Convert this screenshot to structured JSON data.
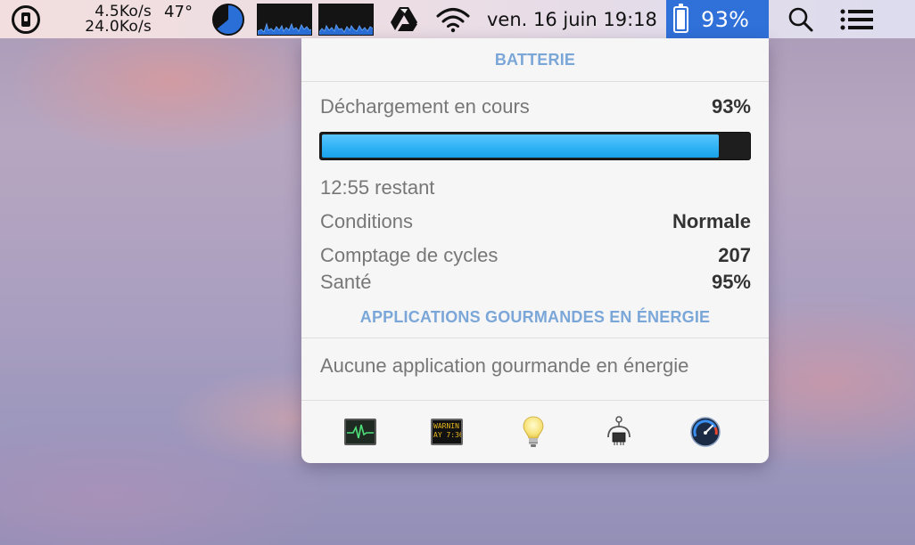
{
  "menubar": {
    "net_up": "4.5Ko/s",
    "net_down": "24.0Ko/s",
    "temperature": "47°",
    "cpu_pie_fraction": 0.64,
    "datetime": "ven. 16 juin 19:18",
    "battery_percent": "93%",
    "icons": [
      "onepassword-icon",
      "cpu-pie-icon",
      "cpu-graph-icon",
      "memory-graph-icon",
      "google-drive-icon",
      "wifi-icon",
      "battery-icon",
      "spotlight-search-icon",
      "notification-center-icon"
    ],
    "colors": {
      "battery_highlight": "#2f70d9"
    }
  },
  "popover": {
    "battery_title": "BATTERIE",
    "status_label": "Déchargement en cours",
    "status_value": "93%",
    "charge_fraction": 0.93,
    "remaining": "12:55 restant",
    "condition_label": "Conditions",
    "condition_value": "Normale",
    "cycles_label": "Comptage de cycles",
    "cycles_value": "207",
    "health_label": "Santé",
    "health_value": "95%",
    "apps_title": "APPLICATIONS GOURMANDES EN ÉNERGIE",
    "no_apps": "Aucune application gourmande en énergie",
    "console_text_1": "WARNIN",
    "console_text_2": "AY 7:36",
    "tools": [
      "activity-monitor-icon",
      "console-icon",
      "tips-lightbulb-icon",
      "system-information-icon",
      "disk-utility-gauge-icon"
    ],
    "colors": {
      "section_title": "#7ba6d8",
      "bar_fill": "#2fb3f5"
    }
  }
}
